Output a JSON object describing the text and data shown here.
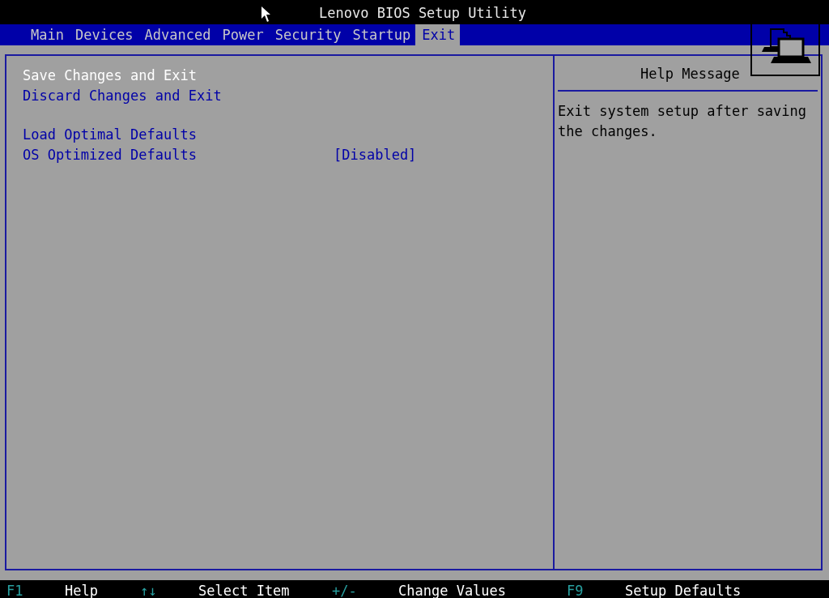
{
  "window": {
    "title": "Lenovo BIOS Setup Utility"
  },
  "tabs": [
    {
      "label": "Main",
      "selected": false
    },
    {
      "label": "Devices",
      "selected": false
    },
    {
      "label": "Advanced",
      "selected": false
    },
    {
      "label": "Power",
      "selected": false
    },
    {
      "label": "Security",
      "selected": false
    },
    {
      "label": "Startup",
      "selected": false
    },
    {
      "label": "Exit",
      "selected": true
    }
  ],
  "menu_groups": [
    [
      {
        "label": "Save Changes and Exit",
        "selected": true
      },
      {
        "label": "Discard Changes and Exit",
        "selected": false
      }
    ],
    [
      {
        "label": "Load Optimal Defaults",
        "selected": false
      },
      {
        "label": "OS Optimized Defaults",
        "selected": false,
        "value": "[Disabled]"
      }
    ]
  ],
  "help": {
    "title": "Help Message",
    "text": "Exit system setup after saving the changes."
  },
  "status_bar": [
    {
      "key": "F1",
      "label": "Help"
    },
    {
      "key": "↑↓",
      "label": "Select Item"
    },
    {
      "key": "+/-",
      "label": "Change Values"
    },
    {
      "key": "F9",
      "label": "Setup Defaults"
    }
  ]
}
